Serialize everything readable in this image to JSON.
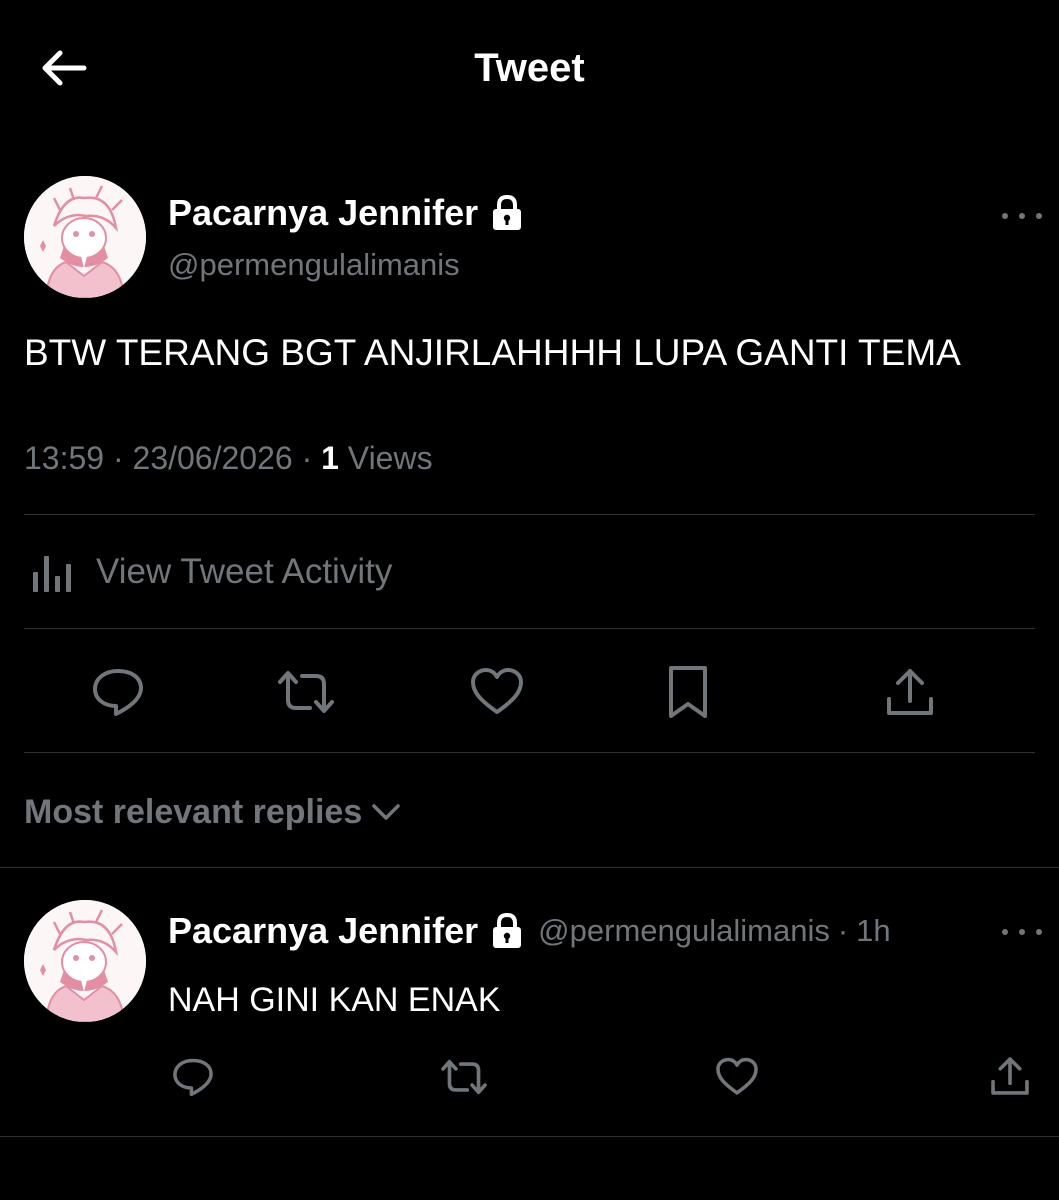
{
  "header": {
    "title": "Tweet",
    "back_icon": "arrow-left-icon"
  },
  "tweet": {
    "author_name": "Pacarnya Jennifer",
    "author_handle": "@permengulalimanis",
    "protected_icon": "lock-icon",
    "text": "BTW TERANG BGT ANJIRLAHHHH LUPA GANTI TEMA",
    "time": "13:59",
    "date": "23/06/2026",
    "separator": "·",
    "views_count": "1",
    "views_label": "Views",
    "activity_label": "View Tweet Activity",
    "actions": [
      "reply-icon",
      "retweet-icon",
      "like-icon",
      "bookmark-icon",
      "share-icon"
    ]
  },
  "replies_section": {
    "sort_label": "Most relevant replies"
  },
  "reply": {
    "author_name": "Pacarnya Jennifer",
    "author_handle": "@permengulalimanis",
    "separator": "·",
    "time": "1h",
    "text": "NAH GINI KAN ENAK",
    "actions": [
      "reply-icon",
      "retweet-icon",
      "like-icon",
      "share-icon"
    ]
  },
  "colors": {
    "background": "#000000",
    "primary_text": "#ffffff",
    "secondary_text": "#71767b",
    "divider": "#2f3336",
    "avatar_accent": "#e28fa4"
  }
}
